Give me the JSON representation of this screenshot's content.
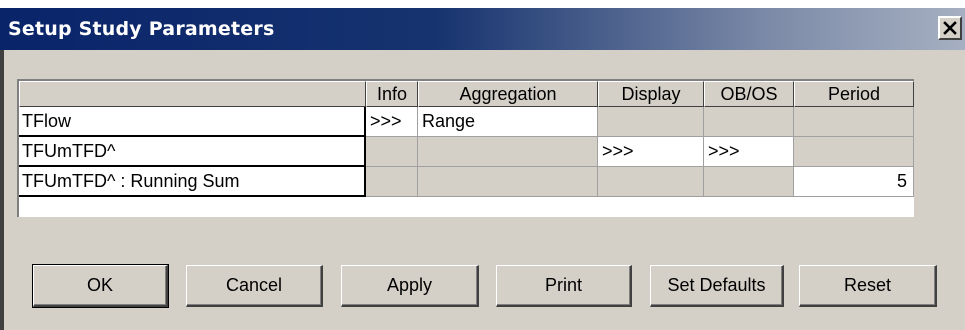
{
  "window": {
    "title": "Setup Study Parameters"
  },
  "grid": {
    "columns": [
      "",
      "Info",
      "Aggregation",
      "Display",
      "OB/OS",
      "Period"
    ],
    "rows": [
      {
        "name": "TFlow",
        "info": ">>>",
        "aggregation": "Range",
        "display": "",
        "obos": "",
        "period": ""
      },
      {
        "name": "TFUmTFD^",
        "info": "",
        "aggregation": "",
        "display": ">>>",
        "obos": ">>>",
        "period": ""
      },
      {
        "name": "TFUmTFD^ : Running Sum",
        "info": "",
        "aggregation": "",
        "display": "",
        "obos": "",
        "period": "5"
      }
    ]
  },
  "buttons": {
    "ok": "OK",
    "cancel": "Cancel",
    "apply": "Apply",
    "print": "Print",
    "set_defaults": "Set Defaults",
    "reset": "Reset"
  },
  "icons": {
    "close": "close-icon"
  },
  "colors": {
    "title_bar": "#0a246a",
    "dialog_face": "#d4d0c8"
  }
}
